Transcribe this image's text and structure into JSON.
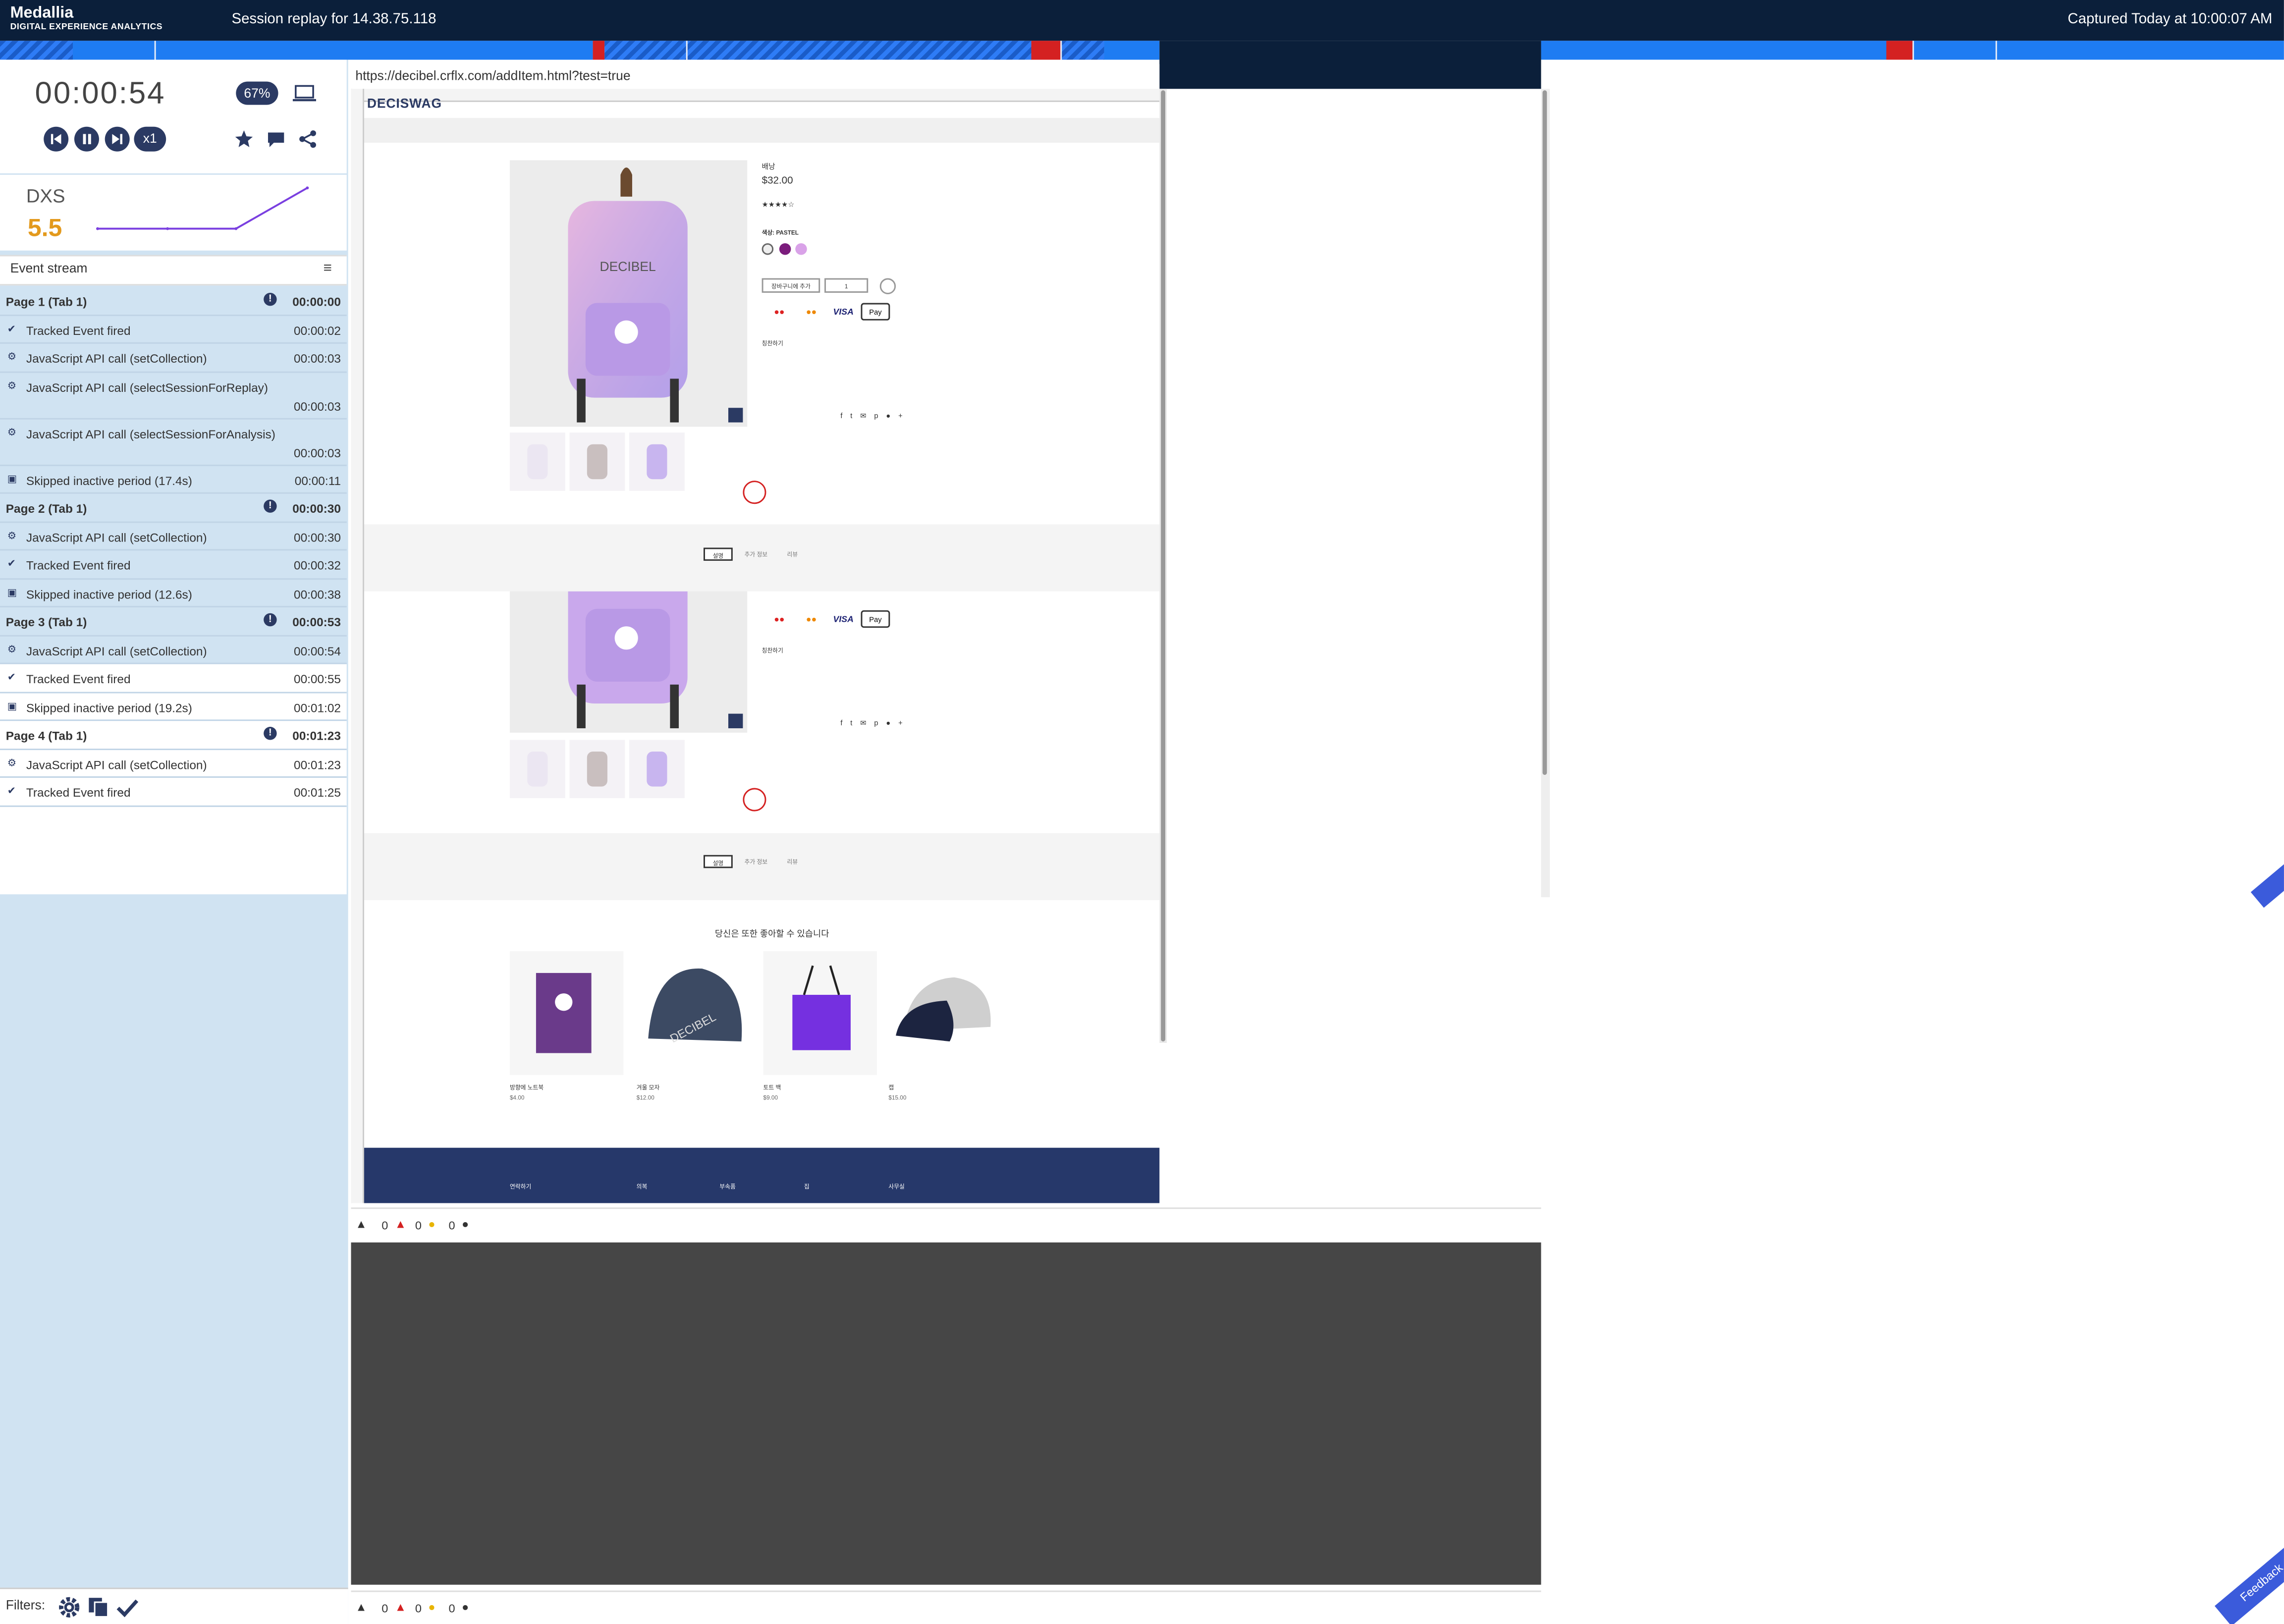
{
  "header": {
    "brand": "Medallia",
    "brand_sub": "DIGITAL EXPERIENCE ANALYTICS",
    "session_title": "Session replay for 14.38.75.118",
    "captured": "Captured Today at 10:00:07 AM"
  },
  "player": {
    "time": "00:00:54",
    "zoom": "67%",
    "speed": "x1",
    "device_icon": "laptop-icon",
    "controls": [
      "skip-back-icon",
      "pause-icon",
      "skip-forward-icon"
    ],
    "actions": [
      "star-icon",
      "comment-icon",
      "share-icon"
    ]
  },
  "dxs": {
    "label": "DXS",
    "value": "5.5",
    "color": "#e39a1d"
  },
  "event_stream": {
    "title": "Event stream",
    "rows": [
      {
        "type": "page",
        "label": "Page 1 (Tab 1)",
        "time": "00:00:00"
      },
      {
        "type": "check",
        "label": "Tracked Event fired",
        "time": "00:00:02"
      },
      {
        "type": "gear",
        "label": "JavaScript API call (setCollection)",
        "time": "00:00:03"
      },
      {
        "type": "gear",
        "label": "JavaScript API call (selectSessionForReplay)",
        "time": "00:00:03"
      },
      {
        "type": "gear",
        "label": "JavaScript API call (selectSessionForAnalysis)",
        "time": "00:00:03"
      },
      {
        "type": "skip",
        "label": "Skipped inactive period (17.4s)",
        "time": "00:00:11"
      },
      {
        "type": "page",
        "label": "Page 2 (Tab 1)",
        "time": "00:00:30"
      },
      {
        "type": "gear",
        "label": "JavaScript API call (setCollection)",
        "time": "00:00:30"
      },
      {
        "type": "check",
        "label": "Tracked Event fired",
        "time": "00:00:32"
      },
      {
        "type": "skip",
        "label": "Skipped inactive period (12.6s)",
        "time": "00:00:38"
      },
      {
        "type": "page",
        "label": "Page 3 (Tab 1)",
        "time": "00:00:53"
      },
      {
        "type": "gear",
        "label": "JavaScript API call (setCollection)",
        "time": "00:00:54"
      },
      {
        "type": "check",
        "label": "Tracked Event fired",
        "time": "00:00:55"
      },
      {
        "type": "skip",
        "label": "Skipped inactive period (19.2s)",
        "time": "00:01:02"
      },
      {
        "type": "page",
        "label": "Page 4 (Tab 1)",
        "time": "00:01:23"
      },
      {
        "type": "gear",
        "label": "JavaScript API call (setCollection)",
        "time": "00:01:23"
      },
      {
        "type": "check",
        "label": "Tracked Event fired",
        "time": "00:01:25"
      }
    ]
  },
  "filters": {
    "label": "Filters:"
  },
  "replay": {
    "url": "https://decibel.crflx.com/addItem.html?test=true",
    "site_logo": "DECISWAG",
    "product_title": "배낭",
    "price": "$32.00",
    "color_label": "색상: PASTEL",
    "qty": "1",
    "add_to_cart": "장바구니에 추가",
    "wishlist": "칭찬하기",
    "payments": [
      "Maestro",
      "Mastercard",
      "VISA",
      "Apple Pay"
    ],
    "tabs": [
      "설명",
      "추가 정보",
      "리뷰"
    ],
    "recommend_title": "당신은 또한 좋아할 수 있습니다",
    "recommended": [
      {
        "name": "방향에 노트북",
        "price": "$4.00"
      },
      {
        "name": "겨울 모자",
        "price": "$12.00"
      },
      {
        "name": "토트 백",
        "price": "$9.00"
      },
      {
        "name": "캡",
        "price": "$15.00"
      }
    ],
    "footer_links": [
      "연락하기",
      "의복",
      "부속품",
      "집",
      "사무실"
    ]
  },
  "console": {
    "counts": [
      "0",
      "0",
      "0",
      "0"
    ]
  },
  "feedback": {
    "label": "Feedback"
  }
}
